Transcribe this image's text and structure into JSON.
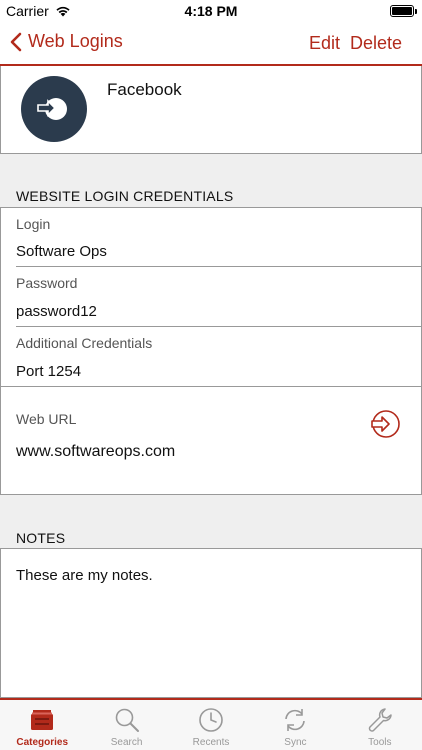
{
  "status": {
    "carrier": "Carrier",
    "time": "4:18 PM"
  },
  "nav": {
    "back_label": "Web Logins",
    "edit_label": "Edit",
    "delete_label": "Delete"
  },
  "entry": {
    "title": "Facebook",
    "icon": "login-arrow-icon"
  },
  "credentials": {
    "section_title": "WEBSITE LOGIN CREDENTIALS",
    "login_label": "Login",
    "login_value": "Software Ops",
    "password_label": "Password",
    "password_value": "password12",
    "additional_label": "Additional Credentials",
    "additional_value": "Port 1254",
    "url_label": "Web URL",
    "url_value": "www.softwareops.com"
  },
  "notes": {
    "section_title": "NOTES",
    "text": "These are my notes."
  },
  "tabs": [
    {
      "label": "Categories",
      "icon": "categories-icon",
      "active": true
    },
    {
      "label": "Search",
      "icon": "search-icon",
      "active": false
    },
    {
      "label": "Recents",
      "icon": "clock-icon",
      "active": false
    },
    {
      "label": "Sync",
      "icon": "sync-icon",
      "active": false
    },
    {
      "label": "Tools",
      "icon": "wrench-icon",
      "active": false
    }
  ],
  "colors": {
    "accent": "#b22a1b",
    "avatar_bg": "#2b3b4d"
  }
}
